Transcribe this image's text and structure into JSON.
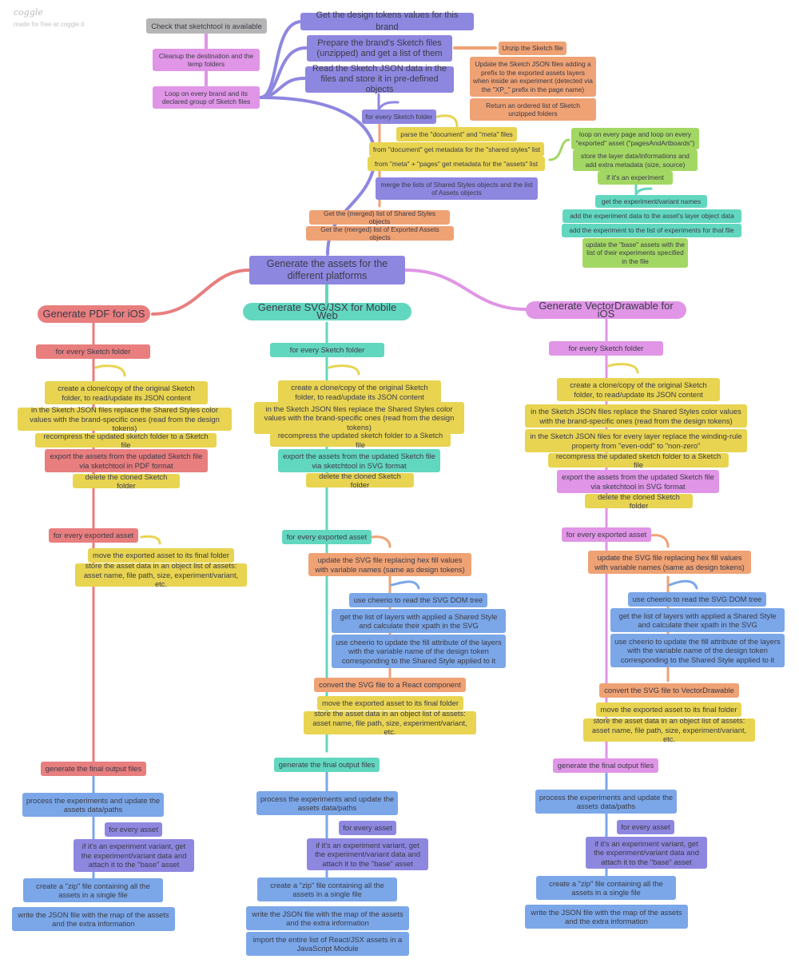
{
  "watermark": {
    "title": "coggle",
    "subtitle": "made for free at coggle.it"
  },
  "colors": {
    "gray": "#b5b5b5",
    "pink": "#e095e6",
    "purple": "#8e87e0",
    "orange": "#efa274",
    "yellow": "#e8d451",
    "green": "#a3d764",
    "teal": "#62d7c0",
    "red": "#e87e7e",
    "blue": "#7ba7e8"
  },
  "setup": {
    "check": "Check that sketchtool is available",
    "cleanup": "Cleanup the destination and the temp folders",
    "loop": "Loop on every brand and its declared group of Sketch files"
  },
  "brand": {
    "tokens": "Get the design tokens values for this brand",
    "prepare": "Prepare the brand's Sketch files (unzipped) and get a list of them",
    "read": "Read the Sketch JSON data in the files and store it in pre-defined objects"
  },
  "prepare_steps": [
    "Unzip the Sketch file",
    "Update the Sketch JSON files adding a prefix to the exported assets layers when inside an experiment (detected via the \"XP_\" prefix in the page name)",
    "Return an ordered list of Sketch unzipped folders"
  ],
  "read_steps": {
    "for_every_folder": "for every Sketch folder",
    "parse": "parse the \"document\" and \"meta\" files",
    "from_document": "from \"document\" get metadata for the \"shared styles\" list",
    "from_meta": "from \"meta\" + \"pages\" get metadata for the \"assets\" list",
    "merge": "merge the lists of Shared Styles objects and the list of Assets objects",
    "get_shared": "Get the (merged) list of Shared Styles objects",
    "get_exported": "Get the (merged) list of Exported Assets objects"
  },
  "meta_steps": {
    "loop_pages": "loop on every page and loop on every \"exported\" asset (\"pagesAndArtboards\")",
    "store_layer": "store the layer data/informations and add extra metadata (size, source)",
    "if_experiment": "if it's an experiment",
    "get_names": "get the experiment/variant names",
    "add_data": "add the experiment data to the asset's layer object data",
    "add_list": "add the experiment to the list of experiments for that file",
    "update_base": "update the \"base\" assets with the list of their experiments specified in the file"
  },
  "generate": "Generate the assets for the different platforms",
  "platforms": [
    {
      "id": "pdf-ios",
      "title": "Generate PDF for iOS",
      "for_every_folder": "for every Sketch folder",
      "clone": "create a clone/copy of the original Sketch folder, to read/update its JSON content",
      "replace_colors": "in the Sketch JSON files replace the Shared Styles color values with the brand-specific ones (read from the design tokens)",
      "recompress": "recompress the updated sketch folder to a Sketch file",
      "export": "export the assets from the updated Sketch file via sketchtool in PDF format",
      "delete": "delete the cloned Sketch folder",
      "for_every_asset": "for every exported asset",
      "move": "move the exported asset to its final folder",
      "store": "store the asset data in an object list of assets: asset name, file path, size, experiment/variant, etc.",
      "final_output": "generate the final output files",
      "process": "process the experiments and update the assets data/paths",
      "for_asset": "for every asset",
      "variant": "if it's an experiment variant, get the experiment/variant data and attach it to the \"base\" asset",
      "zip": "create a \"zip\" file containing all the assets in a single file",
      "write_json": "write the JSON file with the map of the assets and the extra information"
    },
    {
      "id": "svg-jsx-web",
      "title": "Generate SVG/JSX for Mobile Web",
      "for_every_folder": "for every Sketch folder",
      "clone": "create a clone/copy of the original Sketch folder, to read/update its JSON content",
      "replace_colors": "in the Sketch JSON files replace the Shared Styles color values with the brand-specific ones (read from the design tokens)",
      "recompress": "recompress the updated sketch folder to a Sketch file",
      "export": "export the assets from the updated Sketch file via sketchtool in SVG format",
      "delete": "delete the cloned Sketch folder",
      "for_every_asset": "for every exported asset",
      "update_svg": "update the SVG file replacing hex fill values with variable names (same as design tokens)",
      "cheerio_read": "use cheerio to read the SVG DOM tree",
      "get_layers": "get the list of layers with applied a Shared Style and calculate their xpath in the SVG",
      "cheerio_update": "use cheerio to update the fill attribute of the layers with the variable name of the design token corresponding to the Shared Style applied to it",
      "convert": "convert the SVG file to a React component",
      "move": "move the exported asset to its final folder",
      "store": "store the asset data in an object list of assets: asset name, file path, size, experiment/variant, etc.",
      "final_output": "generate the final output files",
      "process": "process the experiments and update the assets data/paths",
      "for_asset": "for every asset",
      "variant": "if it's an experiment variant, get the experiment/variant data and attach it to the \"base\" asset",
      "zip": "create a \"zip\" file containing all the assets in a single file",
      "write_json": "write the JSON file with the map of the assets and the extra information",
      "import_module": "import the entire list of React/JSX assets in a JavaScript Module"
    },
    {
      "id": "vectordrawable",
      "title": "Generate VectorDrawable for iOS",
      "for_every_folder": "for every Sketch folder",
      "clone": "create a clone/copy of the original Sketch folder, to read/update its JSON content",
      "replace_colors": "in the Sketch JSON files replace the Shared Styles color values with the brand-specific ones (read from the design tokens)",
      "winding": "in the Sketch JSON files for every layer replace the winding-rule property from \"even-odd\" to \"non-zero\"",
      "recompress": "recompress the updated sketch folder to a Sketch file",
      "export": "export the assets from the updated Sketch file via sketchtool in SVG format",
      "delete": "delete the cloned Sketch folder",
      "for_every_asset": "for every exported asset",
      "update_svg": "update the SVG file replacing hex fill values with variable names (same as design tokens)",
      "cheerio_read": "use cheerio to read the SVG DOM tree",
      "get_layers": "get the list of layers with applied a Shared Style and calculate their xpath in the SVG",
      "cheerio_update": "use cheerio to update the fill attribute of the layers with the variable name of the design token corresponding to the Shared Style applied to it",
      "convert": "convert the SVG file to VectorDrawable",
      "move": "move the exported asset to its final folder",
      "store": "store the asset data in an object list of assets: asset name, file path, size, experiment/variant, etc.",
      "final_output": "generate the final output files",
      "process": "process the experiments and update the assets data/paths",
      "for_asset": "for every asset",
      "variant": "if it's an experiment variant, get the experiment/variant data and attach it to the \"base\" asset",
      "zip": "create a \"zip\" file containing all the assets in a single file",
      "write_json": "write the JSON file with the map of the assets and the extra information"
    }
  ]
}
